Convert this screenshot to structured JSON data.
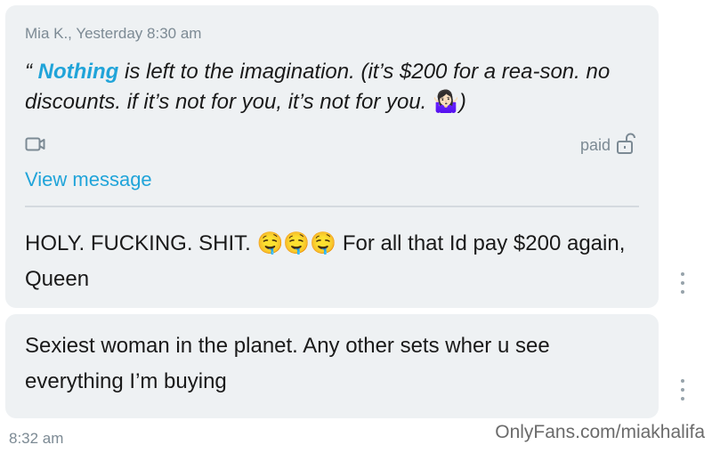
{
  "message_group": {
    "meta": "Mia K., Yesterday 8:30 am",
    "quote": {
      "open_mark": "“ ",
      "highlight": "Nothing",
      "text": " is left to the imagination. (it’s $200 for a rea-son. no discounts. if it’s not for you, it’s not for you. ",
      "emoji": "🤷🏻‍♀️",
      "close": ")"
    },
    "attachment_icon": "video-camera-icon",
    "paid_label": "paid",
    "paid_icon": "unlock-icon",
    "view_message": "View message",
    "reply": "HOLY. FUCKING. SHIT. 🤤🤤🤤 For all that Id pay $200 again, Queen"
  },
  "second_message": {
    "text": "Sexiest woman in the planet. Any other sets wher u see everything I’m buying"
  },
  "timestamp": "8:32 am",
  "watermark": "OnlyFans.com/miakhalifa",
  "colors": {
    "accent": "#20a4d9",
    "bubble": "#eef1f3",
    "muted": "#7c8a94"
  }
}
